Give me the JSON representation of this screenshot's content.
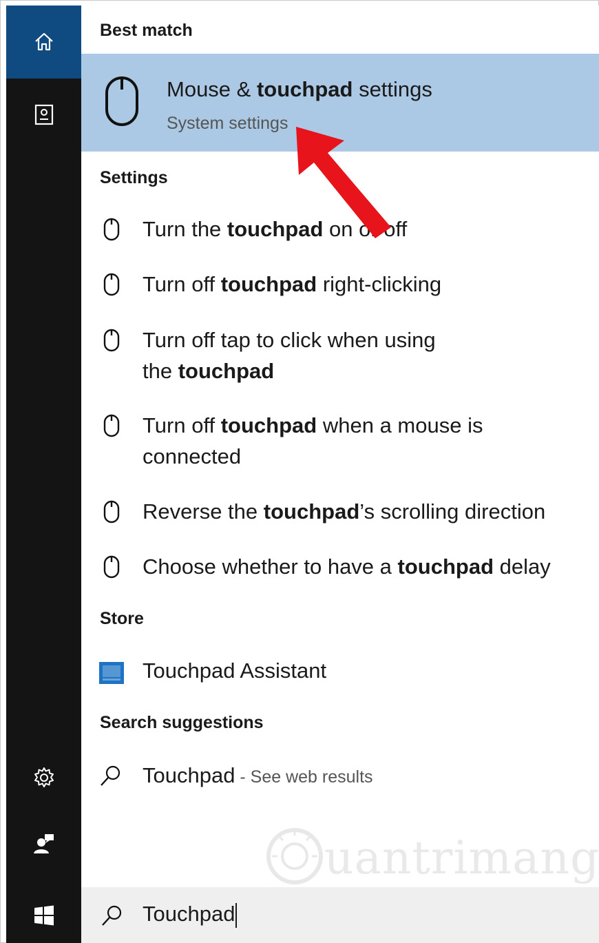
{
  "sidebar": {
    "items": [
      {
        "icon": "home-icon"
      },
      {
        "icon": "notebook-icon"
      },
      {
        "icon": "settings-gear-icon"
      },
      {
        "icon": "feedback-person-icon"
      },
      {
        "icon": "windows-logo-icon"
      }
    ],
    "colors": {
      "background": "#141414",
      "home_selected": "#0f4a81"
    }
  },
  "best_match": {
    "header": "Best match",
    "title_pre": "Mouse & ",
    "title_bold": "touchpad",
    "title_post": " settings",
    "subtitle": "System settings",
    "icon": "mouse-icon",
    "highlight_color": "#abc9e4"
  },
  "settings": {
    "header": "Settings",
    "items": [
      {
        "lines": [
          {
            "pre": "Turn the ",
            "bold": "touchpad",
            "post": " on or off"
          }
        ]
      },
      {
        "lines": [
          {
            "pre": "Turn off ",
            "bold": "touchpad",
            "post": " right-clicking"
          }
        ]
      },
      {
        "lines": [
          {
            "pre": "Turn off tap to click when using",
            "bold": "",
            "post": ""
          },
          {
            "pre": "the ",
            "bold": "touchpad",
            "post": ""
          }
        ]
      },
      {
        "lines": [
          {
            "pre": "Turn off ",
            "bold": "touchpad",
            "post": " when a mouse is"
          },
          {
            "pre": "connected",
            "bold": "",
            "post": ""
          }
        ]
      },
      {
        "lines": [
          {
            "pre": "Reverse the ",
            "bold": "touchpad",
            "post": "’s scrolling direction"
          }
        ]
      },
      {
        "lines": [
          {
            "pre": "Choose whether to have a ",
            "bold": "touchpad",
            "post": " delay"
          }
        ]
      }
    ]
  },
  "store": {
    "header": "Store",
    "items": [
      {
        "label": "Touchpad Assistant",
        "icon": "store-app-tile-icon",
        "tile_color": "#1e73c4"
      }
    ]
  },
  "search_suggestions": {
    "header": "Search suggestions",
    "items": [
      {
        "label": "Touchpad",
        "hint": " - See web results",
        "icon": "search-icon"
      }
    ]
  },
  "searchbox": {
    "value": "Touchpad",
    "icon": "search-icon"
  },
  "annotation": {
    "color": "#e8141b"
  },
  "watermark": {
    "text": "uantrimang"
  }
}
